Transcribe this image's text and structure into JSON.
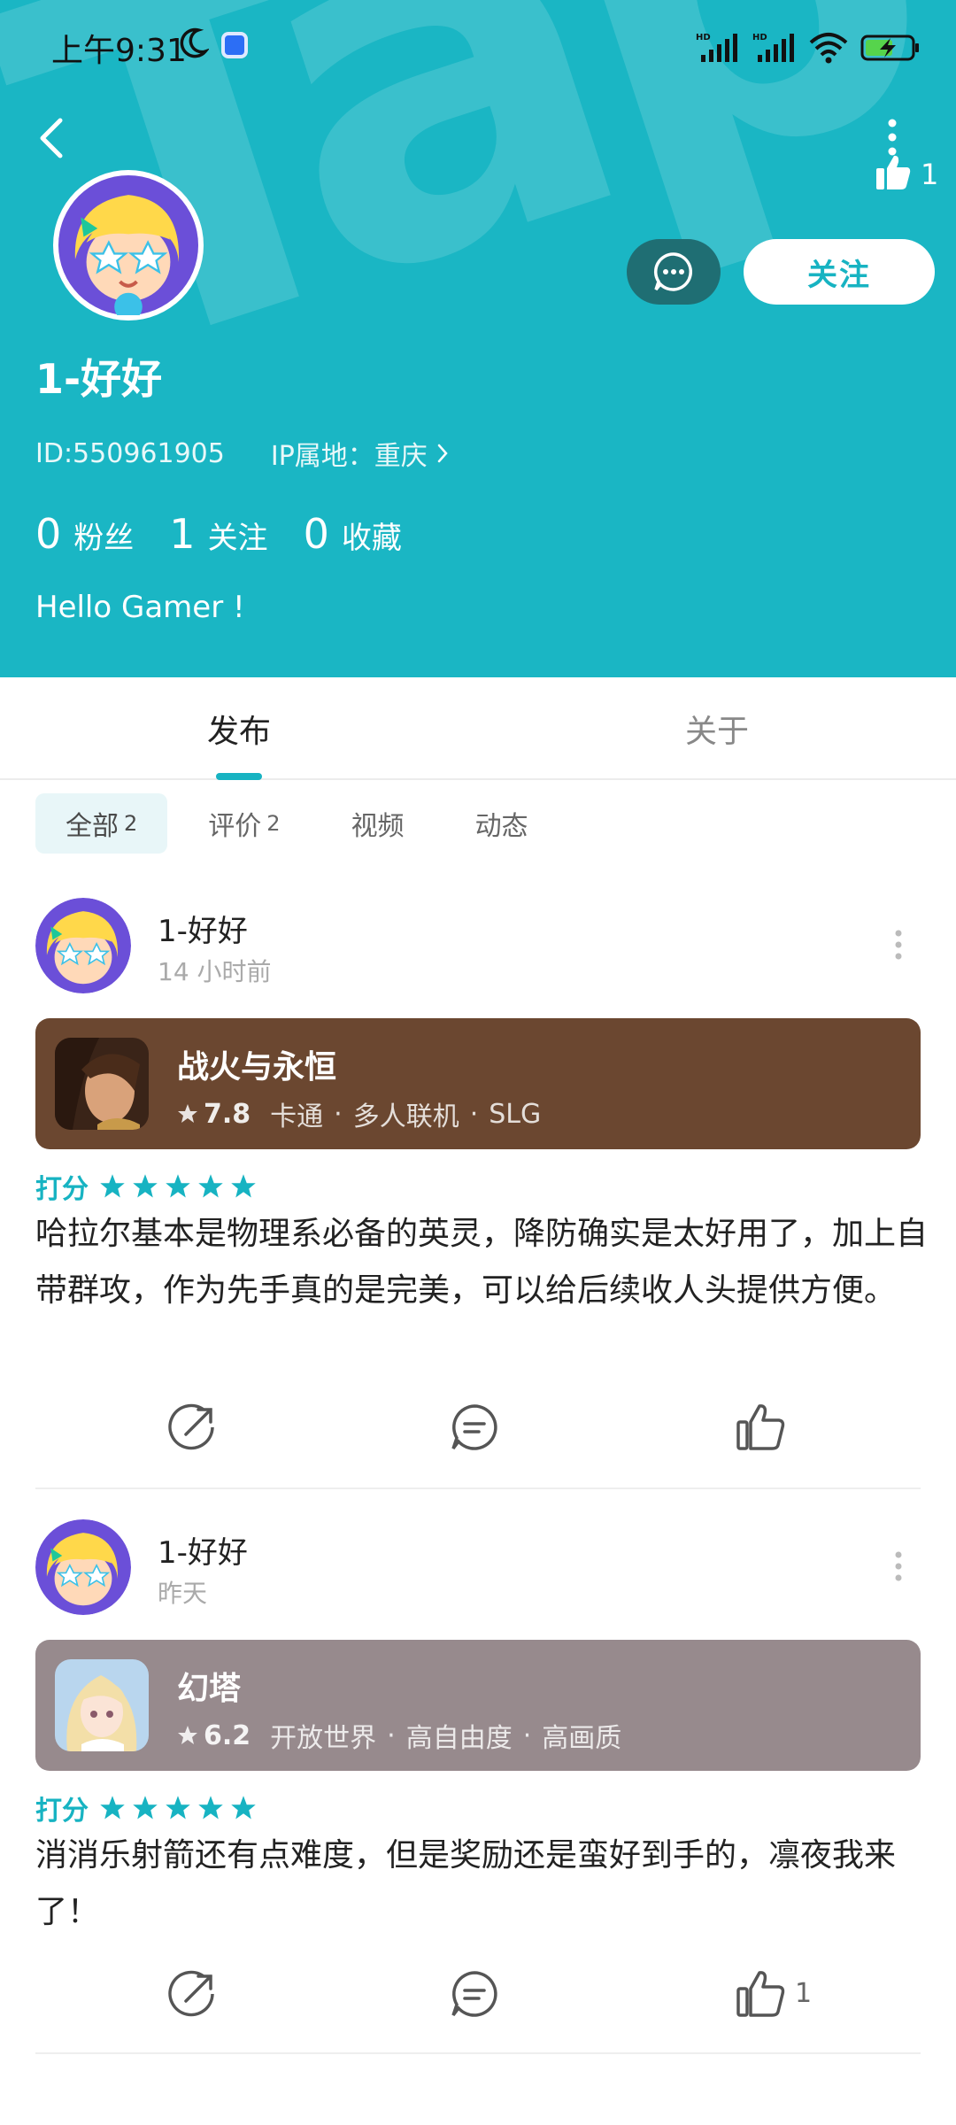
{
  "status_bar": {
    "time": "上午9:31"
  },
  "header": {
    "top_like_count": "1",
    "username": "1-好好",
    "id_text": "ID:550961905",
    "ip_text": "IP属地：重庆",
    "follow_label": "关注",
    "stats": [
      {
        "count": "0",
        "label": "粉丝"
      },
      {
        "count": "1",
        "label": "关注"
      },
      {
        "count": "0",
        "label": "收藏"
      }
    ],
    "bio": "Hello Gamer !",
    "colors": {
      "background": "#1ab6c4",
      "chat_button": "#1f6e73",
      "accent": "#17b3c2"
    }
  },
  "tabs": [
    {
      "label": "发布",
      "active": true
    },
    {
      "label": "关于",
      "active": false
    }
  ],
  "filters": [
    {
      "label": "全部",
      "count": "2",
      "active": true
    },
    {
      "label": "评价",
      "count": "2",
      "active": false
    },
    {
      "label": "视频",
      "count": "",
      "active": false
    },
    {
      "label": "动态",
      "count": "",
      "active": false
    }
  ],
  "posts": [
    {
      "author": "1-好好",
      "time": "14 小时前",
      "game": {
        "title": "战火与永恒",
        "score": "7.8",
        "tags": [
          "卡通",
          "多人联机",
          "SLG"
        ],
        "card_color": "#6b4730"
      },
      "rating_label": "打分",
      "rating_stars": 5,
      "text": "哈拉尔基本是物理系必备的英灵，降防确实是太好用了，加上自带群攻，作为先手真的是完美，可以给后续收人头提供方便。",
      "like_count": ""
    },
    {
      "author": "1-好好",
      "time": "昨天",
      "game": {
        "title": "幻塔",
        "score": "6.2",
        "tags": [
          "开放世界",
          "高自由度",
          "高画质"
        ],
        "card_color": "#978a8d"
      },
      "rating_label": "打分",
      "rating_stars": 5,
      "text": "消消乐射箭还有点难度，但是奖励还是蛮好到手的，凛夜我来了！",
      "like_count": "1"
    }
  ]
}
